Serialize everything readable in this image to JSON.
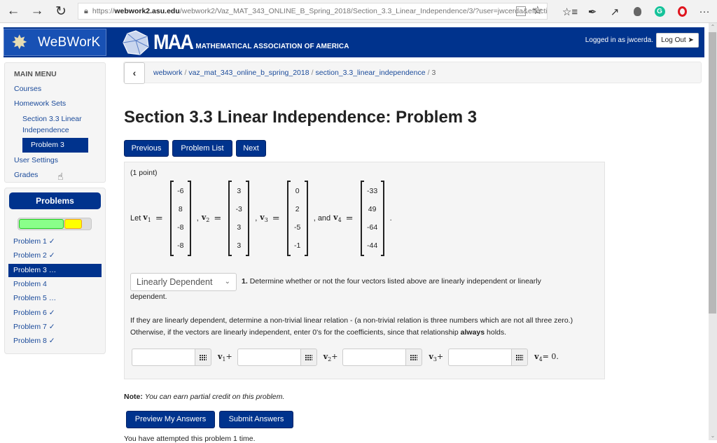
{
  "browser": {
    "url_prefix": "https://",
    "url_host": "webwork2.asu.edu",
    "url_rest": "/webwork2/Vaz_MAT_343_ONLINE_B_Spring_2018/Section_3.3_Linear_Independence/3/?user=jwcerda&effectiv",
    "icons": [
      "back-icon",
      "forward-icon",
      "refresh-icon",
      "lock-icon",
      "reading-view-icon",
      "favorite-star-icon",
      "favorites-list-icon",
      "pen-icon",
      "share-icon",
      "lightbulb-icon",
      "grammarly-icon",
      "opera-icon",
      "more-icon"
    ],
    "more_label": "···"
  },
  "header": {
    "webwork_logo": "WeBWorK",
    "maa_logo": "MAA",
    "maa_full": "MATHEMATICAL ASSOCIATION OF AMERICA",
    "login_text": "Logged in as jwcerda.",
    "logout_label": "Log Out"
  },
  "sidebar": {
    "main_menu_title": "MAIN MENU",
    "links": {
      "courses": "Courses",
      "homework_sets": "Homework Sets",
      "section_line1": "Section 3.3 Linear",
      "section_line2": "Independence",
      "current_problem": "Problem 3",
      "user_settings": "User Settings",
      "grades": "Grades"
    },
    "problems_title": "Problems",
    "progress": {
      "correct_fraction": 0.625,
      "partial_fraction": 0.25,
      "correct_color": "#8aff8a",
      "partial_color": "#ffff00"
    },
    "problems": [
      {
        "label": "Problem 1 ✓",
        "active": false
      },
      {
        "label": "Problem 2 ✓",
        "active": false
      },
      {
        "label": "Problem 3 …",
        "active": true
      },
      {
        "label": "Problem 4",
        "active": false
      },
      {
        "label": "Problem 5 …",
        "active": false
      },
      {
        "label": "Problem 6 ✓",
        "active": false
      },
      {
        "label": "Problem 7 ✓",
        "active": false
      },
      {
        "label": "Problem 8 ✓",
        "active": false
      }
    ]
  },
  "breadcrumb": {
    "items": [
      "webwork",
      "vaz_mat_343_online_b_spring_2018",
      "section_3.3_linear_independence"
    ],
    "current": "3",
    "separator": "/"
  },
  "page": {
    "title": "Section 3.3 Linear Independence: Problem 3",
    "nav_buttons": {
      "previous": "Previous",
      "problem_list": "Problem List",
      "next": "Next"
    }
  },
  "problem": {
    "points": "(1 point)",
    "let": "Let",
    "vectors": [
      {
        "name": "v",
        "sub": "1",
        "values": [
          "-6",
          "8",
          "-8",
          "-8"
        ]
      },
      {
        "name": "v",
        "sub": "2",
        "values": [
          "3",
          "-3",
          "3",
          "3"
        ]
      },
      {
        "name": "v",
        "sub": "3",
        "values": [
          "0",
          "2",
          "-5",
          "-1"
        ]
      },
      {
        "name": "v",
        "sub": "4",
        "values": [
          "-33",
          "49",
          "-64",
          "-44"
        ]
      }
    ],
    "comma": ",",
    "and": ", and",
    "period": ".",
    "equals": "=",
    "dropdown_value": "Linearly Dependent",
    "q1_number": "1.",
    "q1_text": "Determine whether or not the four vectors listed above are linearly independent or linearly",
    "q1_text2": "dependent.",
    "para_text1": "If they are linearly dependent, determine a non-trivial linear relation - (a non-trivial relation is three numbers which are not all three zero.) Otherwise, if the vectors are linearly independent, enter 0's for the coefficients, since that relationship ",
    "para_bold": "always",
    "para_text2": " holds.",
    "answers": [
      {
        "value": "",
        "label_sub": "1",
        "suffix": "+"
      },
      {
        "value": "",
        "label_sub": "2",
        "suffix": "+"
      },
      {
        "value": "",
        "label_sub": "3",
        "suffix": "+"
      },
      {
        "value": "",
        "label_sub": "4",
        "suffix": "= 0."
      }
    ]
  },
  "footer": {
    "note_label": "Note:",
    "note_text": "You can earn partial credit on this problem.",
    "preview_label": "Preview My Answers",
    "submit_label": "Submit Answers",
    "attempts_text": "You have attempted this problem 1 time."
  }
}
